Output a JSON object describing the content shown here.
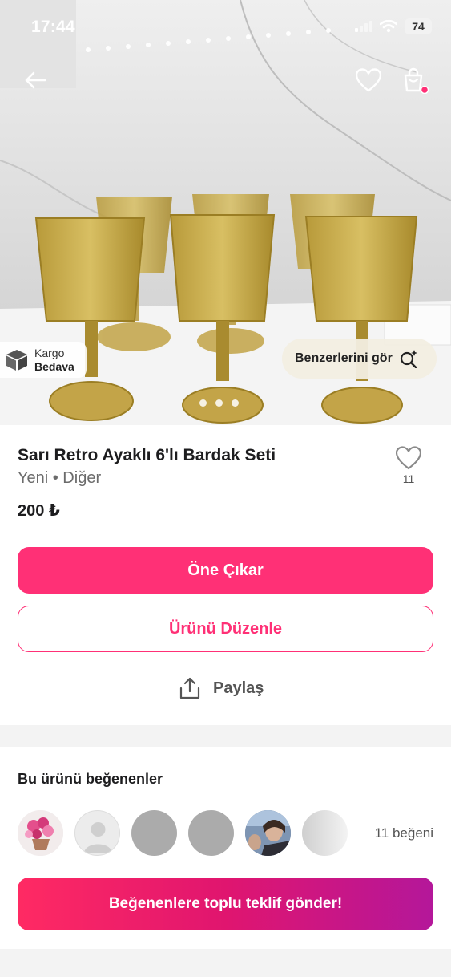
{
  "status_bar": {
    "time": "17:44",
    "battery": "74"
  },
  "listing": {
    "title": "Sarı Retro Ayaklı 6'lı Bardak Seti",
    "subtitle": "Yeni • Diğer",
    "price": "200 ₺",
    "like_count": "11",
    "shipping_line1": "Kargo",
    "shipping_line2": "Bedava",
    "similar_label": "Benzerlerini gör",
    "image_count": 3,
    "active_image": 1
  },
  "actions": {
    "promote_label": "Öne Çıkar",
    "edit_label": "Ürünü Düzenle",
    "share_label": "Paylaş"
  },
  "likers": {
    "title": "Bu ürünü beğenenler",
    "total_label": "11 beğeni",
    "avatars": [
      "flowers-photo",
      "default-avatar",
      "grey-placeholder",
      "grey-placeholder",
      "selfie-photo",
      "grey-placeholder"
    ],
    "offer_label": "Beğenenlere toplu teklif gönder!"
  },
  "colors": {
    "accent": "#ff3076",
    "gradient_end": "#b4179a"
  }
}
